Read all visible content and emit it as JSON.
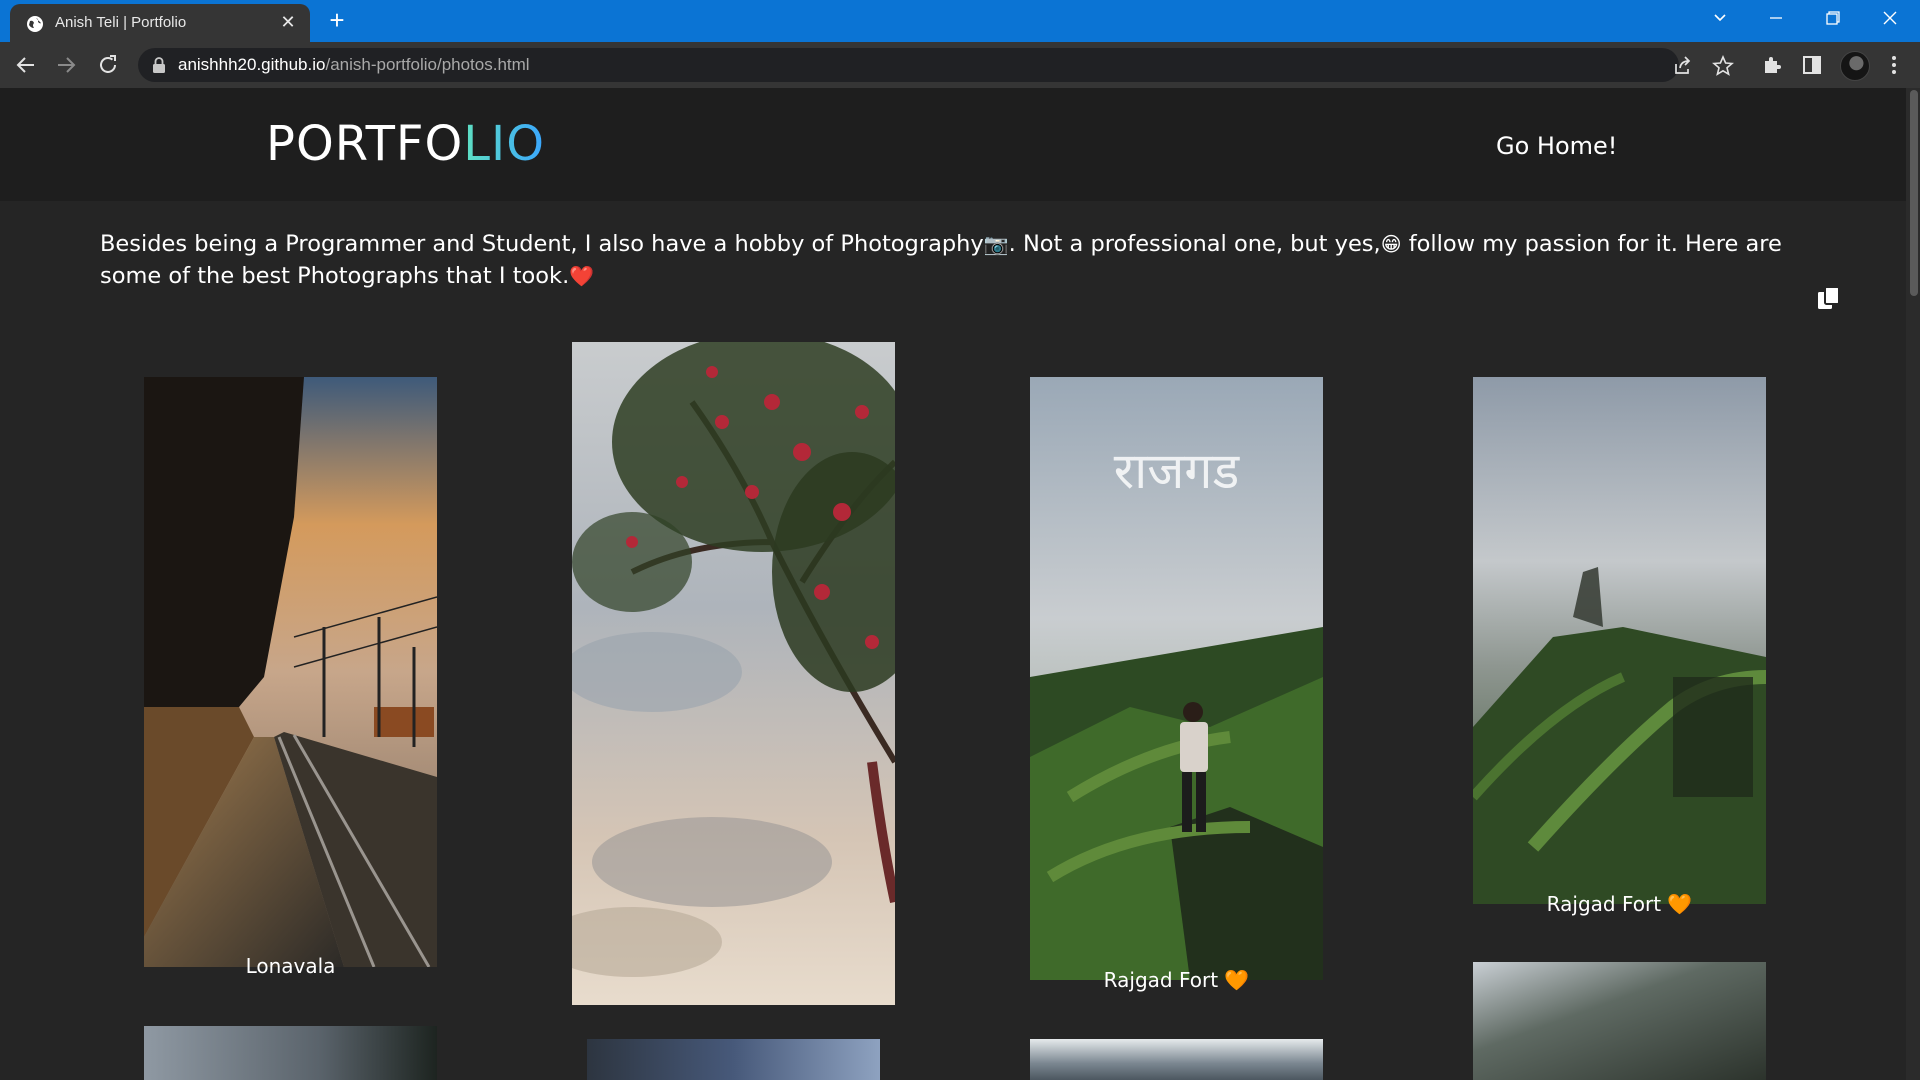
{
  "browser": {
    "tab_title": "Anish Teli | Portfolio",
    "url_host": "anishhh20.github.io",
    "url_path": "/anish-portfolio/photos.html"
  },
  "site": {
    "logo_main": "PORTFO",
    "logo_accent": "LIO",
    "nav_link": "Go Home!"
  },
  "intro": {
    "text_part1": "Besides being a Programmer and Student, I also have a hobby of Photography",
    "camera_emoji": "📷",
    "text_part2": ". Not a professional one, but yes,",
    "grin_emoji": "😁",
    "text_part3": " follow my passion for it. Here are some of the best Photographs that I took.",
    "heart_emoji": "❤️"
  },
  "photos": [
    {
      "caption": "Lonavala",
      "heart": ""
    },
    {
      "caption": "",
      "heart": ""
    },
    {
      "caption": "Rajgad Fort",
      "heart": "🧡",
      "overlay_text": "राजगड"
    },
    {
      "caption": "Rajgad Fort",
      "heart": "🧡"
    }
  ],
  "colors": {
    "tabbar": "#0b74d4",
    "toolbar": "#353535",
    "page_bg": "#252525",
    "header_bg": "#1e1e1e",
    "logo_accent_from": "#5fe0c1",
    "logo_accent_to": "#3aa6ff"
  }
}
